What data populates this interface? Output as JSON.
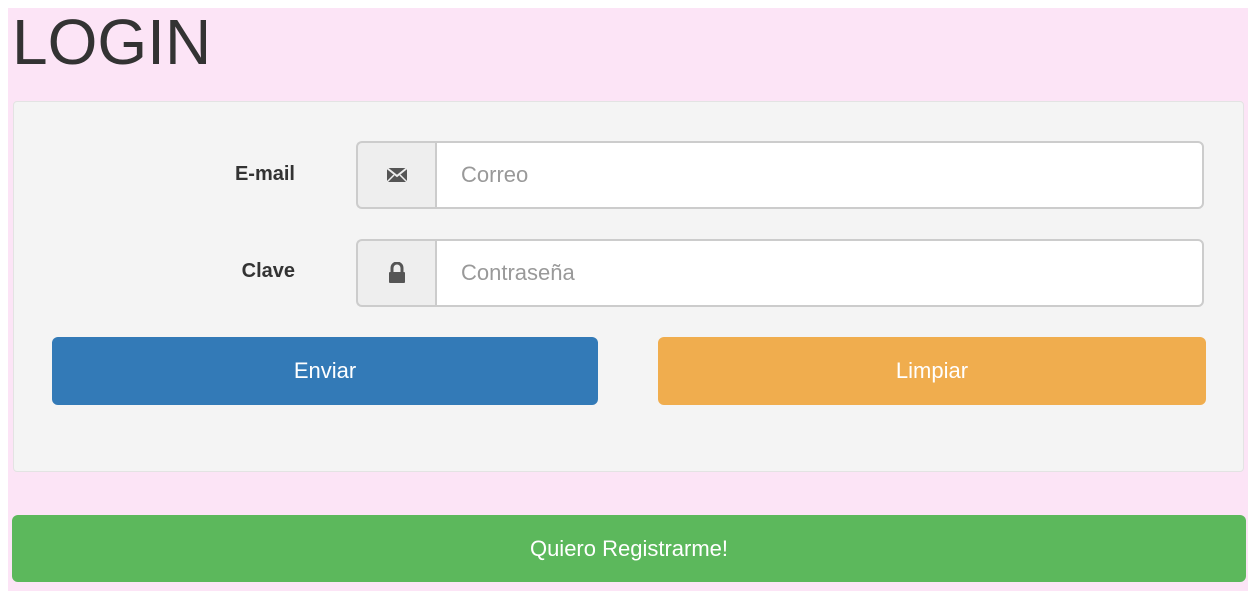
{
  "page": {
    "title": "LOGIN"
  },
  "form": {
    "email": {
      "label": "E-mail",
      "placeholder": "Correo",
      "value": "",
      "icon": "envelope-icon"
    },
    "password": {
      "label": "Clave",
      "placeholder": "Contraseña",
      "value": "",
      "icon": "lock-icon"
    }
  },
  "buttons": {
    "submit_label": "Enviar",
    "clear_label": "Limpiar",
    "register_label": "Quiero Registrarme!"
  },
  "colors": {
    "page_background": "#fce4f6",
    "panel_background": "#f4f4f4",
    "submit": "#337ab7",
    "clear": "#f0ad4e",
    "register": "#5cb85c"
  }
}
